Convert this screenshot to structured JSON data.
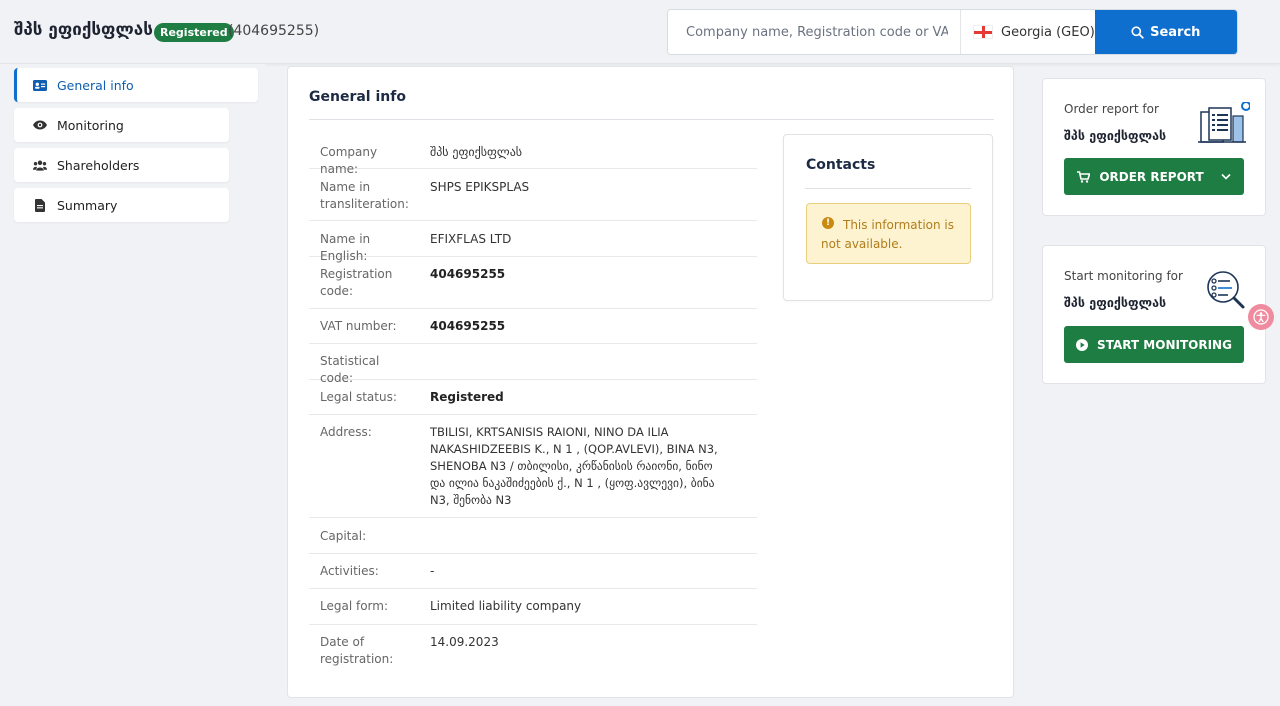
{
  "header": {
    "company_name": "შპს ეფიქსფლას",
    "status_badge": "Registered",
    "registration_code": "(404695255)",
    "search": {
      "placeholder": "Company name, Registration code or VAT code",
      "country": "Georgia (GEO)",
      "button_label": "Search"
    }
  },
  "sidebar": {
    "items": [
      {
        "label": "General info",
        "icon": "id-card-icon",
        "active": true
      },
      {
        "label": "Monitoring",
        "icon": "eye-icon",
        "active": false
      },
      {
        "label": "Shareholders",
        "icon": "users-icon",
        "active": false
      },
      {
        "label": "Summary",
        "icon": "document-icon",
        "active": false
      }
    ]
  },
  "general_info": {
    "title": "General info",
    "rows": [
      {
        "label": "Company name:",
        "value": "შპს ეფიქსფლას",
        "bold": false
      },
      {
        "label": "Name in transliteration:",
        "value": "SHPS EPIKSPLAS",
        "bold": false
      },
      {
        "label": "Name in English:",
        "value": "EFIXFLAS LTD",
        "bold": false
      },
      {
        "label": "Registration code:",
        "value": "404695255",
        "bold": true
      },
      {
        "label": "VAT number:",
        "value": "404695255",
        "bold": true
      },
      {
        "label": "Statistical code:",
        "value": "",
        "bold": false
      },
      {
        "label": "Legal status:",
        "value": "Registered",
        "bold": true
      },
      {
        "label": "Address:",
        "value": "TBILISI, KRTSANISIS RAIONI, NINO DA ILIA NAKASHIDZEEBIS K., N 1 , (QOP.AVLEVI), BINA N3, SHENOBA N3 / თბილისი, კრწანისის რაიონი, ნინო და ილია ნაკაშიძეების ქ., N 1 , (ყოფ.ავლევი), ბინა N3, შენობა N3",
        "bold": true
      },
      {
        "label": "Capital:",
        "value": "",
        "bold": false
      },
      {
        "label": "Activities:",
        "value": "-",
        "bold": false
      },
      {
        "label": "Legal form:",
        "value": "Limited liability company",
        "bold": false
      },
      {
        "label": "Date of registration:",
        "value": "14.09.2023",
        "bold": false
      }
    ]
  },
  "contacts": {
    "title": "Contacts",
    "notice": "This information is not available."
  },
  "order_widget": {
    "label": "Order report for",
    "company": "შპს ეფიქსფლას",
    "button_label": "ORDER REPORT"
  },
  "monitoring_widget": {
    "label": "Start monitoring for",
    "company": "შპს ეფიქსფლას",
    "button_label": "START MONITORING"
  },
  "colors": {
    "primary_blue": "#0f6fcf",
    "success_green": "#1e7d43",
    "warning_bg": "#fdf3d0",
    "warning_text": "#b07d1c"
  }
}
